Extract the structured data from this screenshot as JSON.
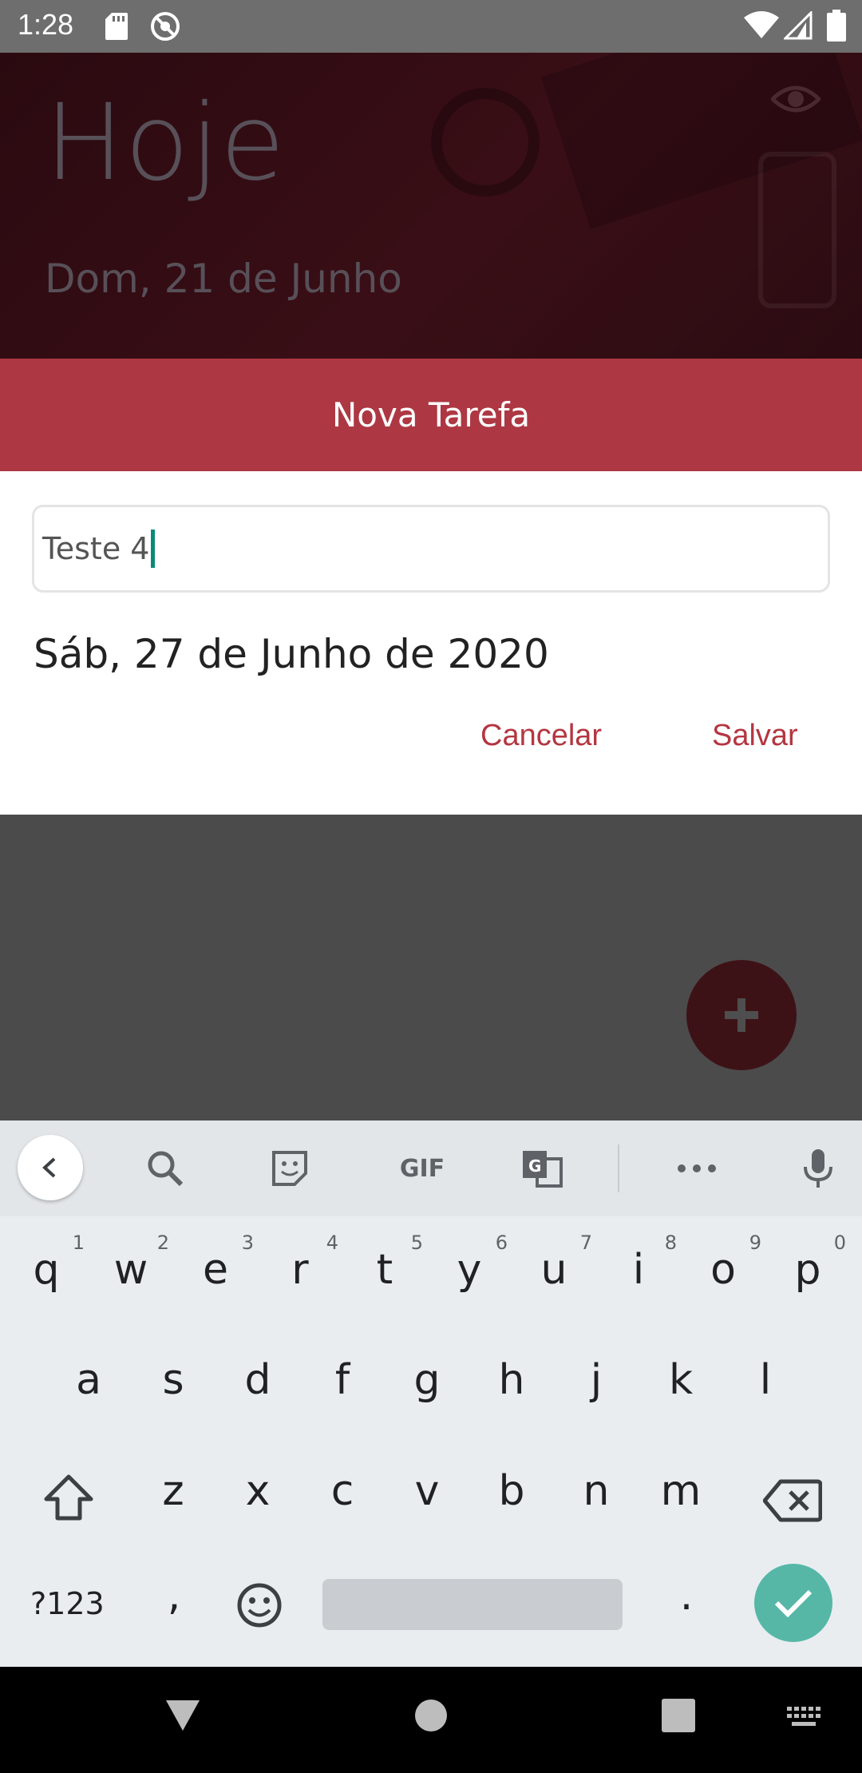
{
  "status_bar": {
    "time": "1:28",
    "icons": [
      "sd-card-icon",
      "do-not-disturb-icon",
      "wifi-icon",
      "signal-icon",
      "battery-icon"
    ]
  },
  "app_header": {
    "title": "Hoje",
    "date": "Dom, 21 de Junho",
    "eye_icon": "eye-icon"
  },
  "dialog": {
    "title": "Nova Tarefa",
    "task_input_value": "Teste 4",
    "date": "Sáb, 27 de Junho de 2020",
    "cancel_label": "Cancelar",
    "save_label": "Salvar"
  },
  "fab": {
    "icon": "plus-icon"
  },
  "keyboard": {
    "toolbar": [
      "back-icon",
      "search-icon",
      "sticker-icon",
      "gif-icon",
      "translate-icon",
      "more-icon",
      "mic-icon"
    ],
    "gif_label": "GIF",
    "row1": [
      {
        "k": "q",
        "h": "1"
      },
      {
        "k": "w",
        "h": "2"
      },
      {
        "k": "e",
        "h": "3"
      },
      {
        "k": "r",
        "h": "4"
      },
      {
        "k": "t",
        "h": "5"
      },
      {
        "k": "y",
        "h": "6"
      },
      {
        "k": "u",
        "h": "7"
      },
      {
        "k": "i",
        "h": "8"
      },
      {
        "k": "o",
        "h": "9"
      },
      {
        "k": "p",
        "h": "0"
      }
    ],
    "row2": [
      "a",
      "s",
      "d",
      "f",
      "g",
      "h",
      "j",
      "k",
      "l"
    ],
    "row3": [
      "z",
      "x",
      "c",
      "v",
      "b",
      "n",
      "m"
    ],
    "symbols_label": "?123",
    "comma": ",",
    "period": "."
  },
  "colors": {
    "accent": "#ad3843",
    "button_text": "#b43641",
    "enter_key": "#56b7a7",
    "cursor": "#0b8a7a"
  }
}
